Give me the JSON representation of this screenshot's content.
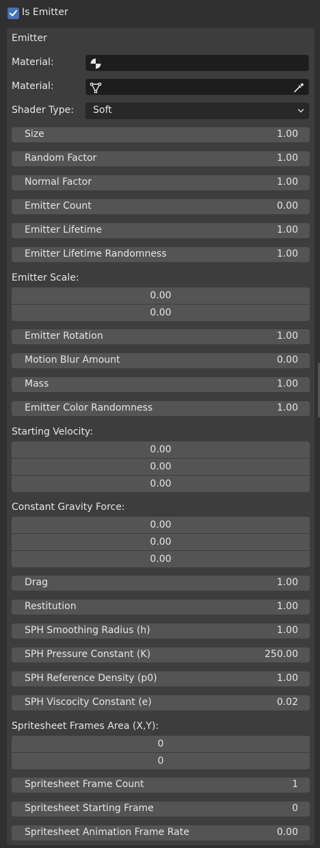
{
  "header": {
    "is_emitter_label": "Is Emitter",
    "is_emitter_checked": true
  },
  "panel": {
    "title": "Emitter",
    "material1": {
      "label": "Material:",
      "value": ""
    },
    "material2": {
      "label": "Material:",
      "value": ""
    },
    "shader": {
      "label": "Shader Type:",
      "value": "Soft"
    },
    "props1": [
      {
        "label": "Size",
        "value": "1.00"
      },
      {
        "label": "Random Factor",
        "value": "1.00"
      },
      {
        "label": "Normal Factor",
        "value": "1.00"
      },
      {
        "label": "Emitter Count",
        "value": "0.00"
      },
      {
        "label": "Emitter Lifetime",
        "value": "1.00"
      },
      {
        "label": "Emitter Lifetime Randomness",
        "value": "1.00"
      }
    ],
    "emitter_scale": {
      "label": "Emitter Scale:",
      "values": [
        "0.00",
        "0.00"
      ]
    },
    "props2": [
      {
        "label": "Emitter Rotation",
        "value": "1.00"
      },
      {
        "label": "Motion Blur Amount",
        "value": "0.00"
      },
      {
        "label": "Mass",
        "value": "1.00"
      },
      {
        "label": "Emitter Color Randomness",
        "value": "1.00"
      }
    ],
    "starting_velocity": {
      "label": "Starting Velocity:",
      "values": [
        "0.00",
        "0.00",
        "0.00"
      ]
    },
    "gravity": {
      "label": "Constant Gravity Force:",
      "values": [
        "0.00",
        "0.00",
        "0.00"
      ]
    },
    "props3": [
      {
        "label": "Drag",
        "value": "1.00"
      },
      {
        "label": "Restitution",
        "value": "1.00"
      },
      {
        "label": "SPH Smoothing Radius (h)",
        "value": "1.00"
      },
      {
        "label": "SPH Pressure Constant (K)",
        "value": "250.00"
      },
      {
        "label": "SPH Reference Density (p0)",
        "value": "1.00"
      },
      {
        "label": "SPH Viscocity Constant (e)",
        "value": "0.02"
      }
    ],
    "frames_area": {
      "label": "Spritesheet Frames Area (X,Y):",
      "values": [
        "0",
        "0"
      ]
    },
    "props4": [
      {
        "label": "Spritesheet Frame Count",
        "value": "1"
      },
      {
        "label": "Spritesheet Starting Frame",
        "value": "0"
      },
      {
        "label": "Spritesheet Animation Frame Rate",
        "value": "0.00"
      }
    ]
  },
  "icons": {
    "checkbox": "checkmark-icon",
    "material1": "material-sphere-icon",
    "material2": "node-group-icon",
    "eyedropper": "eyedropper-icon",
    "dropdown": "chevron-down-icon"
  },
  "colors": {
    "background": "#303030",
    "panel": "#3d3d3d",
    "field": "#545454",
    "input_dark": "#1d1d1d",
    "accent": "#4772b3"
  }
}
